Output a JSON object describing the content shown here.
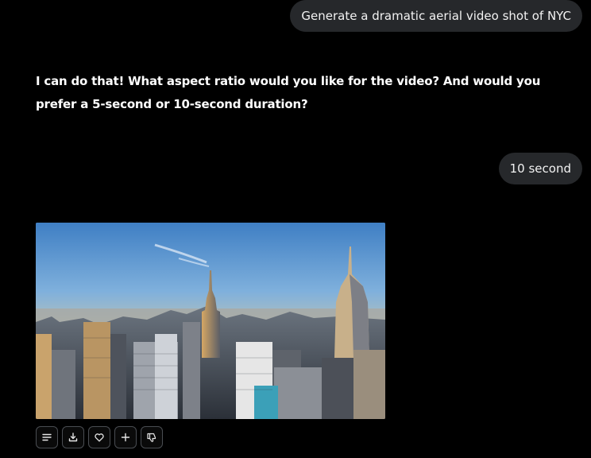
{
  "messages": [
    {
      "role": "user",
      "text": "Generate a dramatic aerial video shot of NYC"
    },
    {
      "role": "assistant",
      "text": "I can do that! What aspect ratio would you like for the video? And would you prefer a 5-second or 10-second duration?"
    },
    {
      "role": "user",
      "text": "10 second"
    }
  ],
  "media": {
    "type": "image",
    "subject": "aerial view of Manhattan skyline at sunset"
  },
  "actions": [
    {
      "icon": "text-lines-icon"
    },
    {
      "icon": "download-icon"
    },
    {
      "icon": "heart-icon"
    },
    {
      "icon": "plus-icon"
    },
    {
      "icon": "thumbs-down-icon"
    }
  ],
  "colors": {
    "background": "#000000",
    "bubble": "#26282b",
    "text": "#ffffff",
    "button_border": "#4a4d52"
  }
}
